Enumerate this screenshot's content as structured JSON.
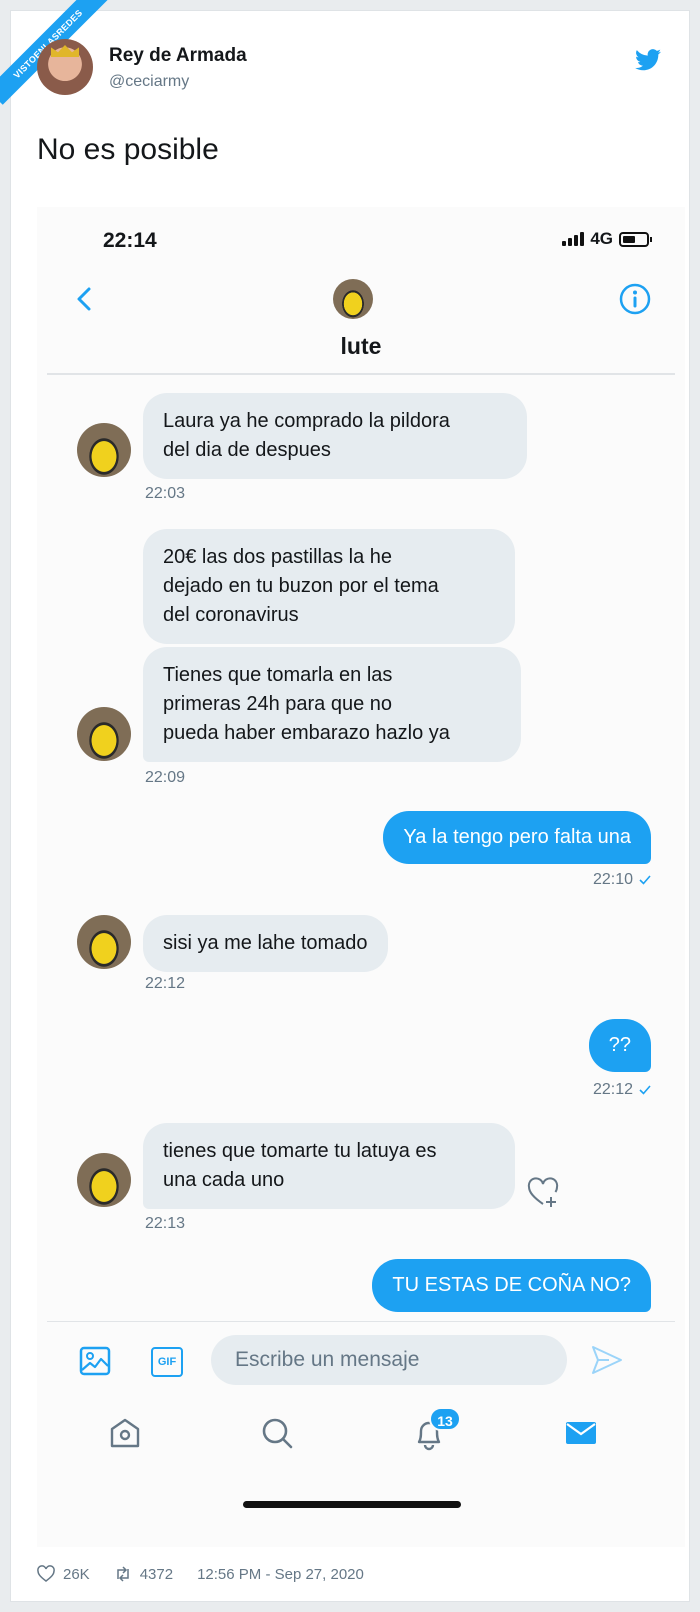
{
  "watermark": "VISTOENLASREDES",
  "tweet": {
    "author_name": "Rey de Armada",
    "author_handle": "@ceciarmy",
    "text": "No es posible",
    "likes": "26K",
    "retweets": "4372",
    "timestamp": "12:56 PM - Sep 27, 2020"
  },
  "phone": {
    "status_time": "22:14",
    "network": "4G",
    "contact_name": "lute",
    "messages": [
      {
        "side": "in",
        "text_lines": [
          "Laura ya he comprado la pildora",
          "del dia de despues"
        ],
        "time": "22:03"
      },
      {
        "side": "in",
        "text_lines": [
          "20€ las dos pastillas la he",
          "dejado en tu buzon por el tema",
          "del coronavirus"
        ]
      },
      {
        "side": "in",
        "text_lines": [
          "Tienes que tomarla en las",
          "primeras 24h para que no",
          "pueda haber embarazo hazlo ya"
        ],
        "time": "22:09"
      },
      {
        "side": "out",
        "text": "Ya la tengo pero falta una",
        "time": "22:10"
      },
      {
        "side": "in",
        "text": "sisi ya me lahe tomado",
        "time": "22:12"
      },
      {
        "side": "out",
        "text": "??",
        "time": "22:12"
      },
      {
        "side": "in",
        "text_lines": [
          "tienes que tomarte tu latuya es",
          "una cada uno"
        ],
        "time": "22:13"
      },
      {
        "side": "out",
        "text": "TU ESTAS DE COÑA NO?"
      }
    ],
    "compose_placeholder": "Escribe un mensaje",
    "gif_label": "GIF",
    "notifications_badge": "13"
  },
  "colors": {
    "accent": "#1da1f2",
    "incoming_bubble": "#e6ecf0",
    "secondary_text": "#657786"
  }
}
